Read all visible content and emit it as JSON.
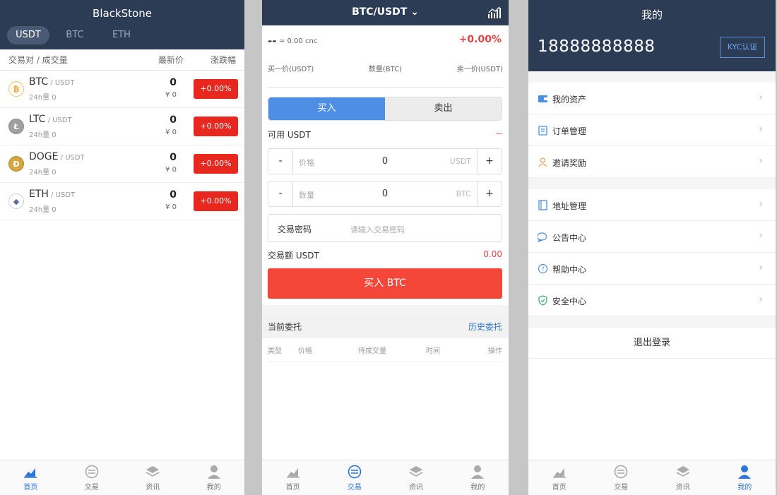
{
  "screen1": {
    "title": "BlackStone",
    "tabs": [
      "USDT",
      "BTC",
      "ETH"
    ],
    "columns": {
      "pair": "交易对 / 成交量",
      "price": "最新价",
      "change": "涨跌幅"
    },
    "markets": [
      {
        "symbol": "BTC",
        "quote": " / USDT",
        "volume": "24h量 0",
        "price": "0",
        "cny": "¥ 0",
        "change": "+0.00%",
        "icon": "btc-coin-icon"
      },
      {
        "symbol": "LTC",
        "quote": " / USDT",
        "volume": "24h量 0",
        "price": "0",
        "cny": "¥ 0",
        "change": "+0.00%",
        "icon": "ltc-coin-icon"
      },
      {
        "symbol": "DOGE",
        "quote": " / USDT",
        "volume": "24h量 0",
        "price": "0",
        "cny": "¥ 0",
        "change": "+0.00%",
        "icon": "doge-coin-icon"
      },
      {
        "symbol": "ETH",
        "quote": " / USDT",
        "volume": "24h量 0",
        "price": "0",
        "cny": "¥ 0",
        "change": "+0.00%",
        "icon": "eth-coin-icon"
      }
    ]
  },
  "screen2": {
    "title": "BTC/USDT",
    "last_price": "--",
    "approx": "≈ 0.00 cnc",
    "change": "+0.00%",
    "headers": [
      "买一价(USDT)",
      "数量(BTC)",
      "卖一价(USDT)"
    ],
    "buy_tab": "买入",
    "sell_tab": "卖出",
    "available_label": "可用 USDT",
    "available_value": "--",
    "price_input": {
      "minus": "-",
      "label": "价格",
      "value": "0",
      "unit": "USDT",
      "plus": "+"
    },
    "amount_input": {
      "minus": "-",
      "label": "数量",
      "value": "0",
      "unit": "BTC",
      "plus": "+"
    },
    "password_label": "交易密码",
    "password_placeholder": "请输入交易密码",
    "total_label": "交易额 USDT",
    "total_value": "0.00",
    "buy_button": "买入 BTC",
    "orders_title": "当前委托",
    "history_link": "历史委托",
    "order_columns": [
      "类型",
      "价格",
      "待成交量",
      "时间",
      "操作"
    ]
  },
  "screen3": {
    "title": "我的",
    "phone": "18888888888",
    "kyc_button": "KYC认证",
    "menu_group1": [
      {
        "label": "我的资产",
        "icon": "wallet-icon"
      },
      {
        "label": "订单管理",
        "icon": "clipboard-icon"
      },
      {
        "label": "邀请奖励",
        "icon": "user-invite-icon"
      }
    ],
    "menu_group2": [
      {
        "label": "地址管理",
        "icon": "address-book-icon"
      },
      {
        "label": "公告中心",
        "icon": "chat-bubble-icon"
      },
      {
        "label": "帮助中心",
        "icon": "question-circle-icon"
      },
      {
        "label": "安全中心",
        "icon": "shield-icon"
      }
    ],
    "chevron": "›",
    "logout": "退出登录"
  },
  "nav": [
    "首页",
    "交易",
    "资讯",
    "我的"
  ],
  "colors": {
    "header": "#2d3c55",
    "accent_blue": "#4e8ee4",
    "red": "#e8281e",
    "active_tab": "#2b76d8"
  }
}
